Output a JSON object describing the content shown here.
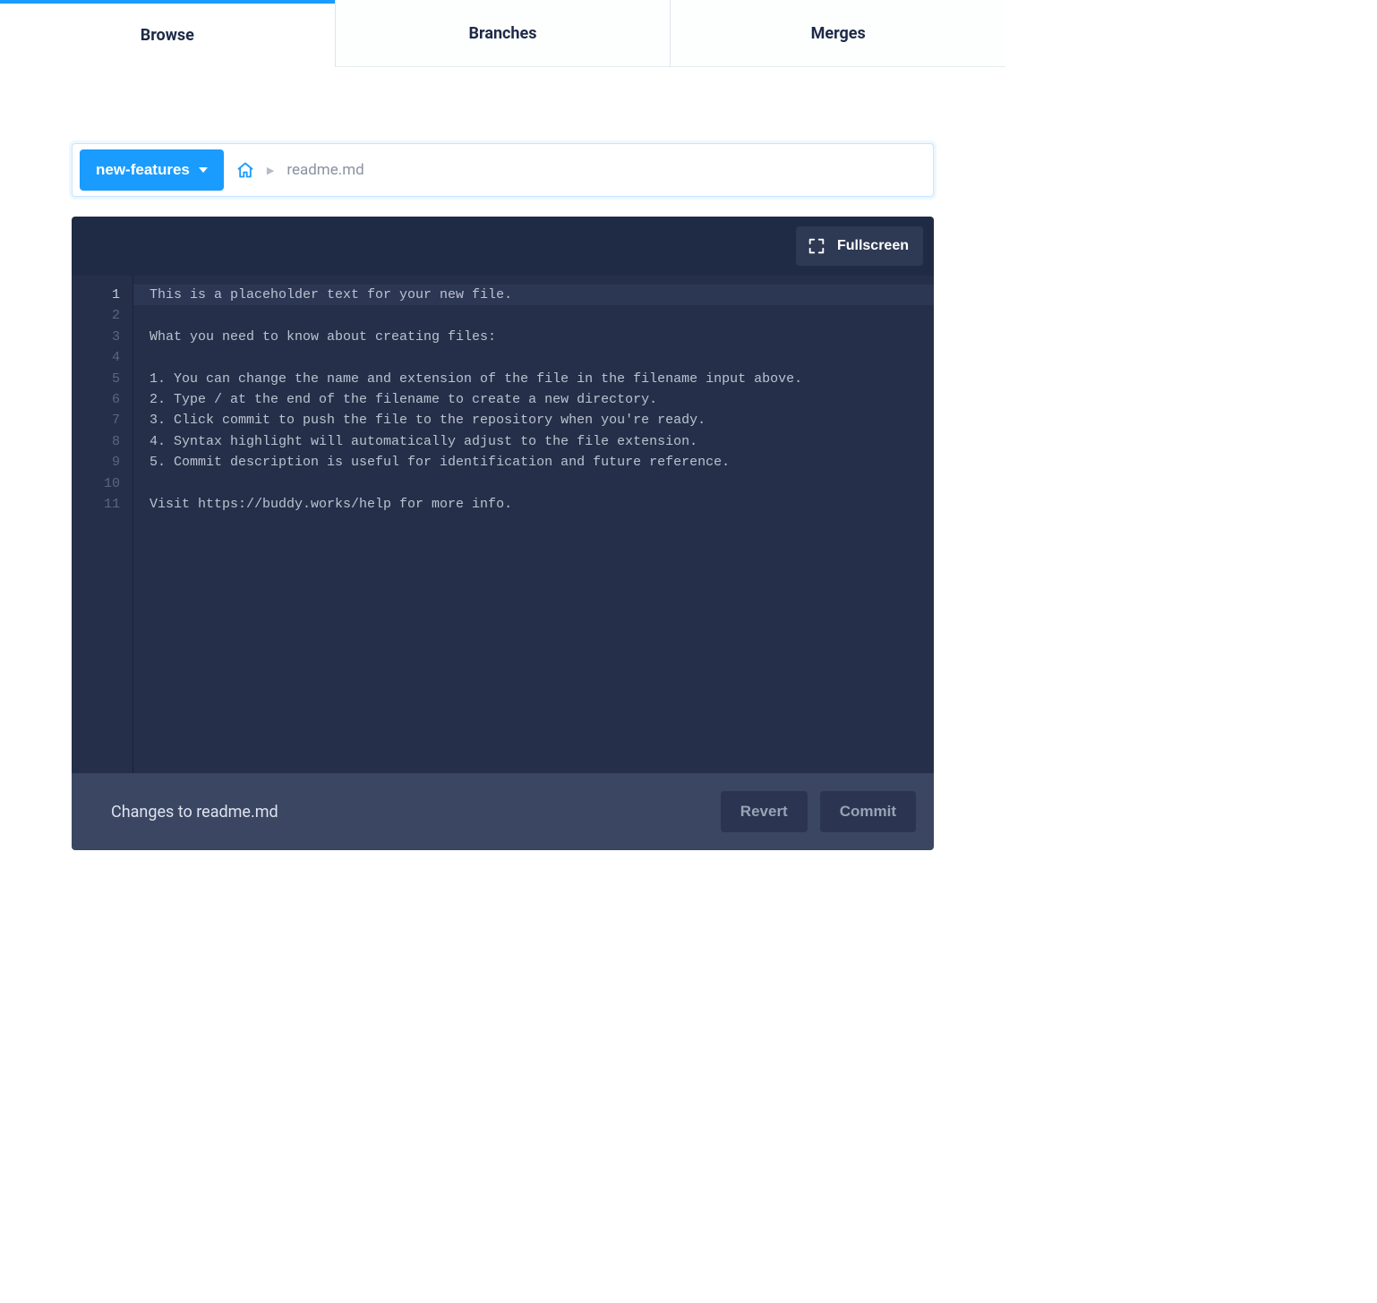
{
  "tabs": {
    "browse": "Browse",
    "branches": "Branches",
    "merges": "Merges",
    "active": "browse"
  },
  "breadcrumb": {
    "branch": "new-features",
    "file": "readme.md"
  },
  "toolbar": {
    "fullscreen": "Fullscreen"
  },
  "editor": {
    "line_count": 11,
    "current_line": 1,
    "lines": {
      "l1": "This is a placeholder text for your new file.",
      "l2": "",
      "l3": "What you need to know about creating files:",
      "l4": "",
      "l5": "1. You can change the name and extension of the file in the filename input above.",
      "l6": "2. Type / at the end of the filename to create a new directory.",
      "l7": "3. Click commit to push the file to the repository when you're ready.",
      "l8": "4. Syntax highlight will automatically adjust to the file extension.",
      "l9": "5. Commit description is useful for identification and future reference.",
      "l10": "",
      "l11": "Visit https://buddy.works/help for more info."
    },
    "gutter": {
      "n1": "1",
      "n2": "2",
      "n3": "3",
      "n4": "4",
      "n5": "5",
      "n6": "6",
      "n7": "7",
      "n8": "8",
      "n9": "9",
      "n10": "10",
      "n11": "11"
    }
  },
  "footer": {
    "changes_label": "Changes to readme.md",
    "revert": "Revert",
    "commit": "Commit"
  }
}
